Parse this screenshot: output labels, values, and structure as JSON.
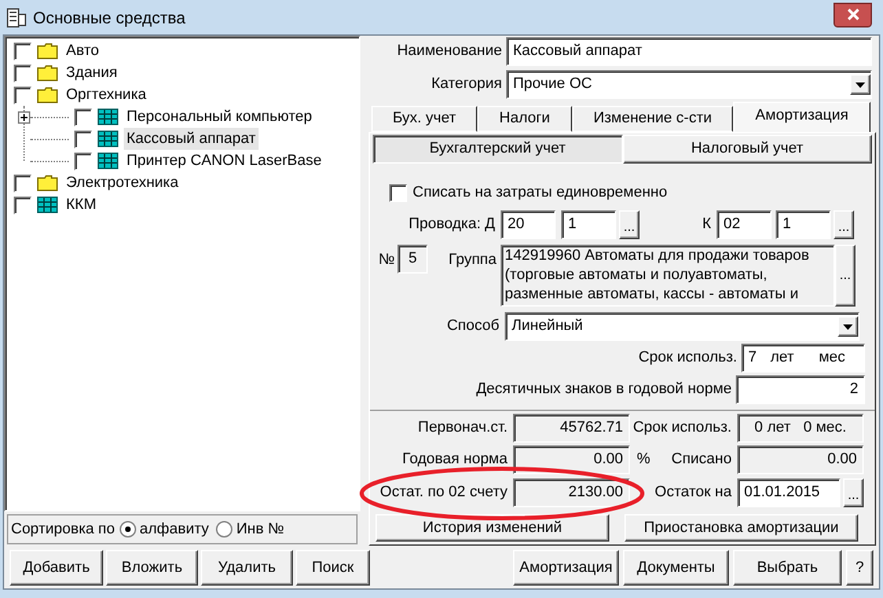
{
  "window": {
    "title": "Основные средства"
  },
  "tree": [
    {
      "label": "Авто",
      "kind": "folder",
      "checked": false,
      "selected": false
    },
    {
      "label": "Здания",
      "kind": "folder",
      "checked": false,
      "selected": false
    },
    {
      "label": "Оргтехника",
      "kind": "folder",
      "checked": false,
      "selected": false,
      "children": [
        {
          "label": "Персональный компьютер",
          "kind": "item",
          "checked": false,
          "selected": false,
          "collapsed": true
        },
        {
          "label": "Кассовый аппарат",
          "kind": "item",
          "checked": false,
          "selected": true,
          "collapsed": false
        },
        {
          "label": "Принтер CANON LaserBase",
          "kind": "item",
          "checked": false,
          "selected": false,
          "collapsed": false
        }
      ]
    },
    {
      "label": "Электротехника",
      "kind": "folder",
      "checked": false,
      "selected": false
    },
    {
      "label": "ККМ",
      "kind": "item",
      "checked": false,
      "selected": false
    }
  ],
  "sort": {
    "label": "Сортировка по",
    "options": [
      {
        "label": "алфавиту",
        "selected": true
      },
      {
        "label": "Инв №",
        "selected": false
      }
    ]
  },
  "left_buttons": [
    "Добавить",
    "Вложить",
    "Удалить",
    "Поиск"
  ],
  "name": {
    "label": "Наименование",
    "value": "Кассовый аппарат"
  },
  "category": {
    "label": "Категория",
    "value": "Прочие ОС"
  },
  "tabs": [
    {
      "label": "Бух. учет",
      "selected": false
    },
    {
      "label": "Налоги",
      "selected": false
    },
    {
      "label": "Изменение с-сти",
      "selected": false
    },
    {
      "label": "Амортизация",
      "selected": true
    }
  ],
  "subtabs": [
    {
      "label": "Бухгалтерский учет",
      "selected": true
    },
    {
      "label": "Налоговый учет",
      "selected": false
    }
  ],
  "writeoff": {
    "label": "Списать на затраты единовременно",
    "checked": false
  },
  "posting": {
    "label": "Проводка: Д",
    "debit": [
      "20",
      "1"
    ],
    "credit_label": "К",
    "credit": [
      "02",
      "1"
    ],
    "browse": "..."
  },
  "number": {
    "label": "№",
    "value": "5"
  },
  "group": {
    "label": "Группа",
    "lines": [
      "142919960 Автоматы для продажи товаров",
      "(торговые автоматы и полуавтоматы,",
      "разменные автоматы, кассы - автоматы и"
    ],
    "browse": "..."
  },
  "method": {
    "label": "Способ",
    "value": "Линейный"
  },
  "term": {
    "label": "Срок использ.",
    "value": "7",
    "years": "лет",
    "months": "мес"
  },
  "decimals": {
    "label": "Десятичных знаков в годовой норме",
    "value": "2"
  },
  "summary": {
    "initial_cost": {
      "label": "Первонач.ст.",
      "value": "45762.71"
    },
    "term_used": {
      "label": "Срок использ.",
      "value": "0 лет   0 мес."
    },
    "annual_rate": {
      "label": "Годовая норма",
      "value": "0.00",
      "unit": "%"
    },
    "written_off": {
      "label": "Списано",
      "value": "0.00"
    },
    "balance_02": {
      "label": "Остат. по 02 счету",
      "value": "2130.00"
    },
    "balance_on": {
      "label": "Остаток на",
      "value": "01.01.2015",
      "browse": "..."
    }
  },
  "panel_buttons": [
    "История изменений",
    "Приостановка амортизации"
  ],
  "bottom_buttons": [
    "Амортизация",
    "Документы",
    "Выбрать",
    "?"
  ]
}
